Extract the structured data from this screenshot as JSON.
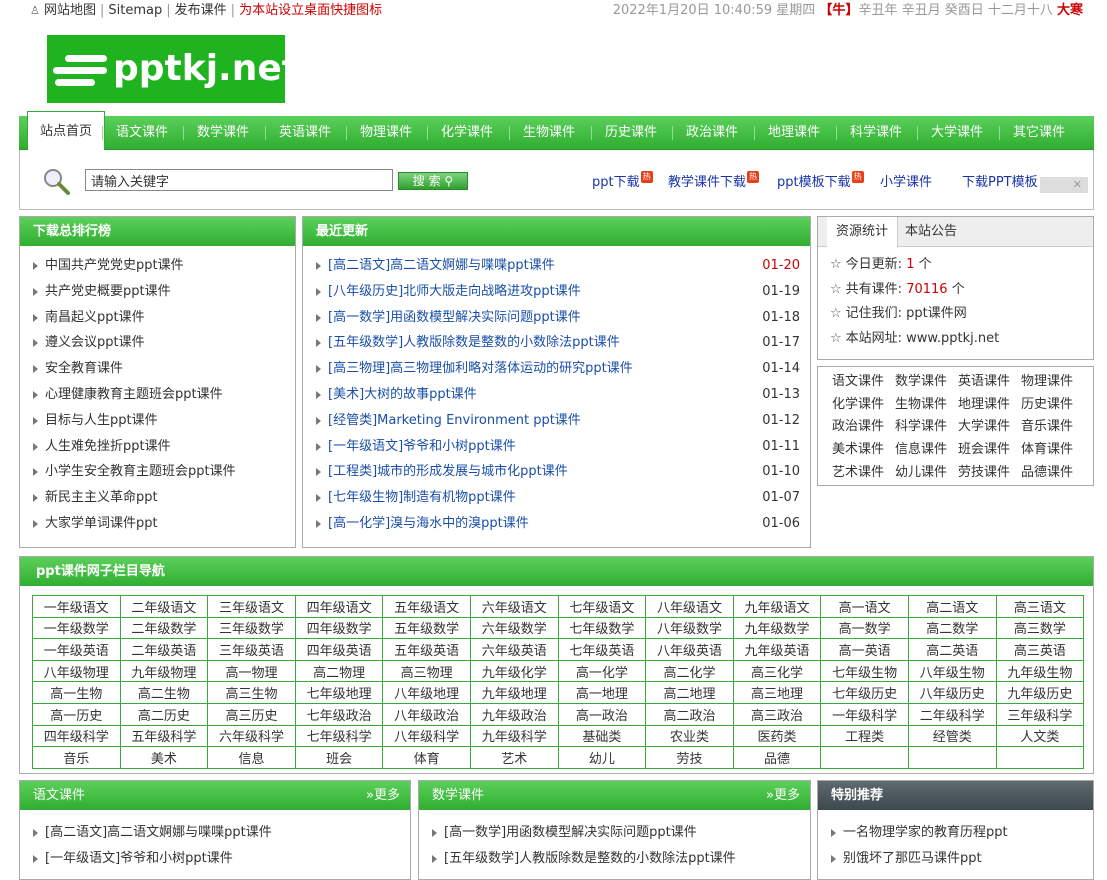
{
  "topbar": {
    "sitemap_cn": "网站地图",
    "sitemap_en": "Sitemap",
    "publish": "发布课件",
    "shortcut": "为本站设立桌面快捷图标",
    "date": "2022年1月20日 10:40:59 星期四",
    "zodiac": "【牛】",
    "lunar": "辛丑年 辛丑月 癸酉日 十二月十八",
    "solar_term": "大寒"
  },
  "logo": {
    "text": "pptkj.net"
  },
  "nav": [
    "站点首页",
    "语文课件",
    "数学课件",
    "英语课件",
    "物理课件",
    "化学课件",
    "生物课件",
    "历史课件",
    "政治课件",
    "地理课件",
    "科学课件",
    "大学课件",
    "其它课件"
  ],
  "search": {
    "placeholder": "请输入关键字",
    "button": "搜 索",
    "links": [
      "ppt下载",
      "教学课件下载",
      "ppt模板下载",
      "小学课件",
      "下载PPT模板"
    ],
    "hot_badge": "热"
  },
  "rank": {
    "title": "下载总排行榜",
    "items": [
      "中国共产党党史ppt课件",
      "共产党史概要ppt课件",
      "南昌起义ppt课件",
      "遵义会议ppt课件",
      "安全教育课件",
      "心理健康教育主题班会ppt课件",
      "目标与人生ppt课件",
      "人生难免挫折ppt课件",
      "小学生安全教育主题班会ppt课件",
      "新民主主义革命ppt",
      "大家学单词课件ppt"
    ]
  },
  "recent": {
    "title": "最近更新",
    "items": [
      {
        "t": "[高二语文]高二语文婀娜与喋喋ppt课件",
        "d": "01-20"
      },
      {
        "t": "[八年级历史]北师大版走向战略进攻ppt课件",
        "d": "01-19"
      },
      {
        "t": "[高一数学]用函数模型解决实际问题ppt课件",
        "d": "01-18"
      },
      {
        "t": "[五年级数学]人教版除数是整数的小数除法ppt课件",
        "d": "01-17"
      },
      {
        "t": "[高三物理]高三物理伽利略对落体运动的研究ppt课件",
        "d": "01-14"
      },
      {
        "t": "[美术]大树的故事ppt课件",
        "d": "01-13"
      },
      {
        "t": "[经管类]Marketing Environment ppt课件",
        "d": "01-12"
      },
      {
        "t": "[一年级语文]爷爷和小树ppt课件",
        "d": "01-11"
      },
      {
        "t": "[工程类]城市的形成发展与城市化ppt课件",
        "d": "01-10"
      },
      {
        "t": "[七年级生物]制造有机物ppt课件",
        "d": "01-07"
      },
      {
        "t": "[高一化学]溴与海水中的溴ppt课件",
        "d": "01-06"
      }
    ]
  },
  "stats": {
    "tabs": [
      "资源统计",
      "本站公告"
    ],
    "today_label": "今日更新:",
    "today_value": "1",
    "today_unit": "个",
    "total_label": "共有课件:",
    "total_value": "70116",
    "total_unit": "个",
    "remember": "记住我们: ppt课件网",
    "url": "本站网址: www.pptkj.net",
    "star": "☆"
  },
  "subjects": [
    "语文课件",
    "数学课件",
    "英语课件",
    "物理课件",
    "化学课件",
    "生物课件",
    "地理课件",
    "历史课件",
    "政治课件",
    "科学课件",
    "大学课件",
    "音乐课件",
    "美术课件",
    "信息课件",
    "班会课件",
    "体育课件",
    "艺术课件",
    "幼儿课件",
    "劳技课件",
    "品德课件"
  ],
  "subnav": {
    "title": "ppt课件网子栏目导航",
    "rows": [
      [
        "一年级语文",
        "二年级语文",
        "三年级语文",
        "四年级语文",
        "五年级语文",
        "六年级语文",
        "七年级语文",
        "八年级语文",
        "九年级语文",
        "高一语文",
        "高二语文",
        "高三语文"
      ],
      [
        "一年级数学",
        "二年级数学",
        "三年级数学",
        "四年级数学",
        "五年级数学",
        "六年级数学",
        "七年级数学",
        "八年级数学",
        "九年级数学",
        "高一数学",
        "高二数学",
        "高三数学"
      ],
      [
        "一年级英语",
        "二年级英语",
        "三年级英语",
        "四年级英语",
        "五年级英语",
        "六年级英语",
        "七年级英语",
        "八年级英语",
        "九年级英语",
        "高一英语",
        "高二英语",
        "高三英语"
      ],
      [
        "八年级物理",
        "九年级物理",
        "高一物理",
        "高二物理",
        "高三物理",
        "九年级化学",
        "高一化学",
        "高二化学",
        "高三化学",
        "七年级生物",
        "八年级生物",
        "九年级生物"
      ],
      [
        "高一生物",
        "高二生物",
        "高三生物",
        "七年级地理",
        "八年级地理",
        "九年级地理",
        "高一地理",
        "高二地理",
        "高三地理",
        "七年级历史",
        "八年级历史",
        "九年级历史"
      ],
      [
        "高一历史",
        "高二历史",
        "高三历史",
        "七年级政治",
        "八年级政治",
        "九年级政治",
        "高一政治",
        "高二政治",
        "高三政治",
        "一年级科学",
        "二年级科学",
        "三年级科学"
      ],
      [
        "四年级科学",
        "五年级科学",
        "六年级科学",
        "七年级科学",
        "八年级科学",
        "九年级科学",
        "基础类",
        "农业类",
        "医药类",
        "工程类",
        "经管类",
        "人文类"
      ],
      [
        "音乐",
        "美术",
        "信息",
        "班会",
        "体育",
        "艺术",
        "幼儿",
        "劳技",
        "品德",
        "",
        "",
        ""
      ]
    ]
  },
  "chinese": {
    "title": "语文课件",
    "more": "»更多",
    "items": [
      "[高二语文]高二语文婀娜与喋喋ppt课件",
      "[一年级语文]爷爷和小树ppt课件"
    ]
  },
  "math": {
    "title": "数学课件",
    "more": "»更多",
    "items": [
      "[高一数学]用函数模型解决实际问题ppt课件",
      "[五年级数学]人教版除数是整数的小数除法ppt课件"
    ]
  },
  "special": {
    "title": "特别推荐",
    "items": [
      "一名物理学家的教育历程ppt",
      "别饿坏了那匹马课件ppt"
    ]
  }
}
